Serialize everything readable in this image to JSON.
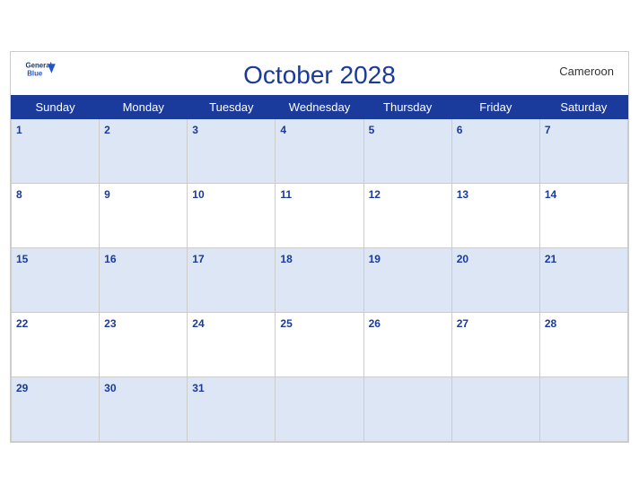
{
  "header": {
    "logo": {
      "general": "General",
      "blue": "Blue",
      "icon_label": "general-blue-logo"
    },
    "title": "October 2028",
    "country": "Cameroon"
  },
  "weekdays": [
    "Sunday",
    "Monday",
    "Tuesday",
    "Wednesday",
    "Thursday",
    "Friday",
    "Saturday"
  ],
  "weeks": [
    {
      "shaded": true,
      "days": [
        {
          "num": "1",
          "empty": false
        },
        {
          "num": "2",
          "empty": false
        },
        {
          "num": "3",
          "empty": false
        },
        {
          "num": "4",
          "empty": false
        },
        {
          "num": "5",
          "empty": false
        },
        {
          "num": "6",
          "empty": false
        },
        {
          "num": "7",
          "empty": false
        }
      ]
    },
    {
      "shaded": false,
      "days": [
        {
          "num": "8"
        },
        {
          "num": "9"
        },
        {
          "num": "10"
        },
        {
          "num": "11"
        },
        {
          "num": "12"
        },
        {
          "num": "13"
        },
        {
          "num": "14"
        }
      ]
    },
    {
      "shaded": true,
      "days": [
        {
          "num": "15"
        },
        {
          "num": "16"
        },
        {
          "num": "17"
        },
        {
          "num": "18"
        },
        {
          "num": "19"
        },
        {
          "num": "20"
        },
        {
          "num": "21"
        }
      ]
    },
    {
      "shaded": false,
      "days": [
        {
          "num": "22"
        },
        {
          "num": "23"
        },
        {
          "num": "24"
        },
        {
          "num": "25"
        },
        {
          "num": "26"
        },
        {
          "num": "27"
        },
        {
          "num": "28"
        }
      ]
    },
    {
      "shaded": true,
      "days": [
        {
          "num": "29"
        },
        {
          "num": "30"
        },
        {
          "num": "31"
        },
        {
          "num": ""
        },
        {
          "num": ""
        },
        {
          "num": ""
        },
        {
          "num": ""
        }
      ]
    }
  ]
}
